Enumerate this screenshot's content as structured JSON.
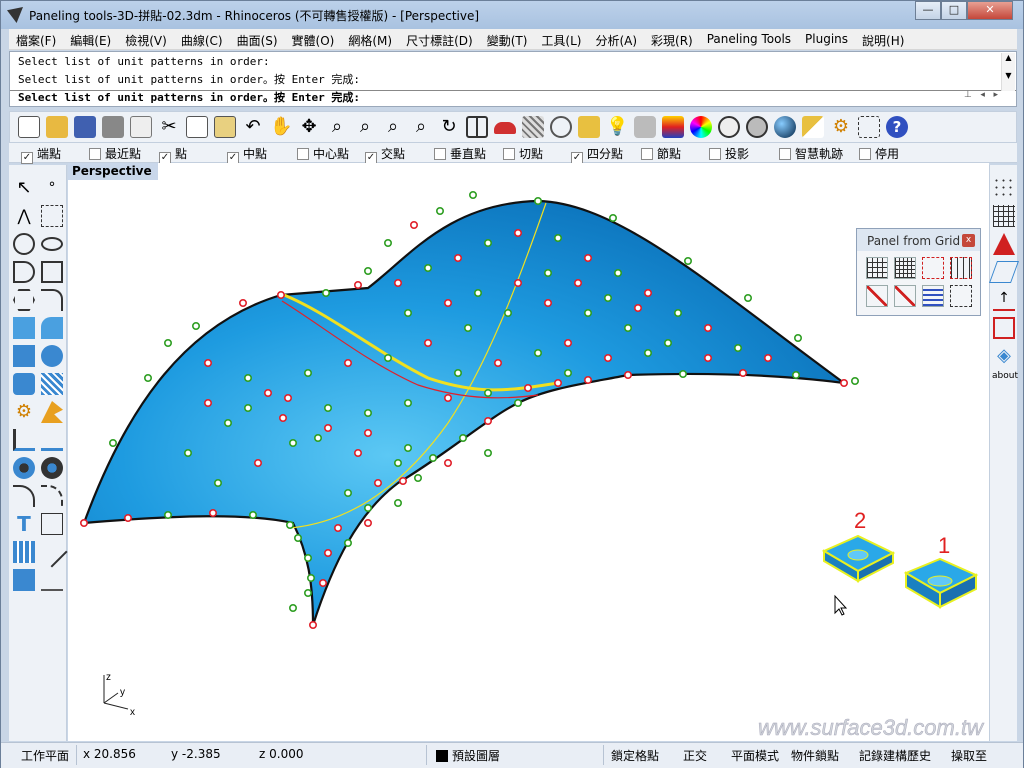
{
  "window": {
    "title": "Paneling tools-3D-拼貼-02.3dm - Rhinoceros (不可轉售授權版) - [Perspective]",
    "minimize_label": "—",
    "maximize_label": "□",
    "close_label": "✕"
  },
  "menu": [
    "檔案(F)",
    "編輯(E)",
    "檢視(V)",
    "曲線(C)",
    "曲面(S)",
    "實體(O)",
    "網格(M)",
    "尺寸標註(D)",
    "變動(T)",
    "工具(L)",
    "分析(A)",
    "彩現(R)",
    "Paneling Tools",
    "Plugins",
    "說明(H)"
  ],
  "command": {
    "history": [
      "Select list of unit patterns in order:",
      "Select list of unit patterns in order。按 Enter 完成:"
    ],
    "prompt": "Select list of unit patterns in order。按 Enter 完成:"
  },
  "osnap": [
    {
      "label": "端點",
      "checked": true
    },
    {
      "label": "最近點",
      "checked": false
    },
    {
      "label": "點",
      "checked": true
    },
    {
      "label": "中點",
      "checked": true
    },
    {
      "label": "中心點",
      "checked": false
    },
    {
      "label": "交點",
      "checked": true
    },
    {
      "label": "垂直點",
      "checked": false
    },
    {
      "label": "切點",
      "checked": false
    },
    {
      "label": "四分點",
      "checked": true
    },
    {
      "label": "節點",
      "checked": false
    },
    {
      "label": "投影",
      "checked": false
    },
    {
      "label": "智慧軌跡",
      "checked": false
    },
    {
      "label": "停用",
      "checked": false
    }
  ],
  "viewport": {
    "label": "Perspective",
    "axis_labels": {
      "z": "z",
      "y": "y",
      "x": "x"
    },
    "annotations": [
      "2",
      "1"
    ],
    "watermark": "www.surface3d.com.tw"
  },
  "panel": {
    "title": "Panel from Grid",
    "close_label": "x"
  },
  "right_toolbar": {
    "about_label": "about"
  },
  "statusbar": {
    "cplane": "工作平面",
    "x": "x 20.856",
    "y": "y -2.385",
    "z": "z 0.000",
    "layer": "預設圖層",
    "items": [
      "鎖定格點",
      "正交",
      "平面模式",
      "物件鎖點",
      "記錄建構歷史",
      "操取至"
    ]
  },
  "colors": {
    "surface": "#1e9be0",
    "green_points": "#2e9e22",
    "red_points": "#e0202a",
    "curve_yellow": "#f0e020",
    "annotation_red": "#e02020"
  }
}
